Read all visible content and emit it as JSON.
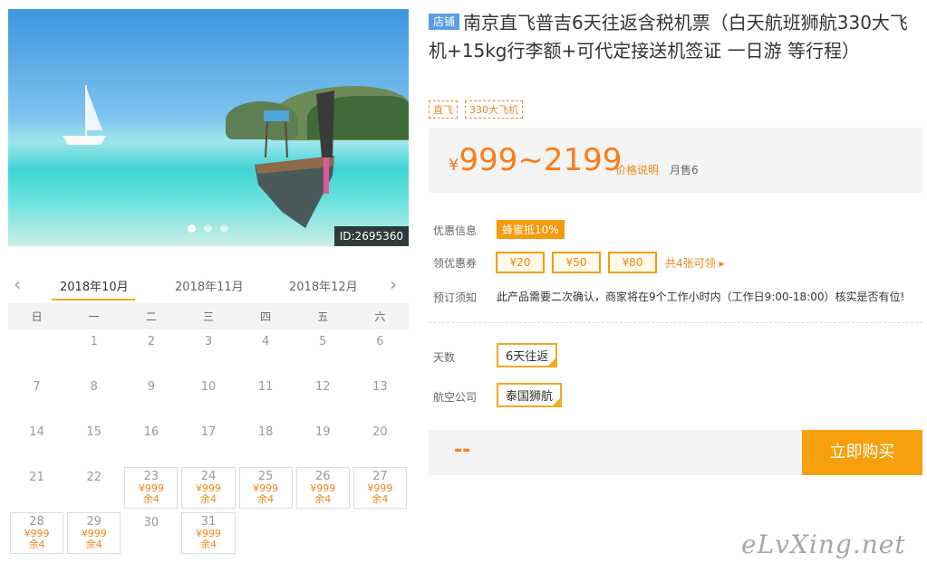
{
  "gallery": {
    "id_label": "ID:2695360",
    "dots": 3,
    "active_dot": 0
  },
  "calendar": {
    "months": [
      "2018年10月",
      "2018年11月",
      "2018年12月"
    ],
    "active_month": 0,
    "weekdays": [
      "日",
      "一",
      "二",
      "三",
      "四",
      "五",
      "六"
    ],
    "weeks": [
      [
        {
          "d": ""
        },
        {
          "d": "1"
        },
        {
          "d": "2"
        },
        {
          "d": "3"
        },
        {
          "d": "4"
        },
        {
          "d": "5"
        },
        {
          "d": "6"
        }
      ],
      [
        {
          "d": "7"
        },
        {
          "d": "8"
        },
        {
          "d": "9"
        },
        {
          "d": "10"
        },
        {
          "d": "11"
        },
        {
          "d": "12"
        },
        {
          "d": "13"
        }
      ],
      [
        {
          "d": "14"
        },
        {
          "d": "15"
        },
        {
          "d": "16"
        },
        {
          "d": "17"
        },
        {
          "d": "18"
        },
        {
          "d": "19"
        },
        {
          "d": "20"
        }
      ],
      [
        {
          "d": "21"
        },
        {
          "d": "22"
        },
        {
          "d": "23",
          "p": "¥999",
          "r": "余4"
        },
        {
          "d": "24",
          "p": "¥999",
          "r": "余4"
        },
        {
          "d": "25",
          "p": "¥999",
          "r": "余4"
        },
        {
          "d": "26",
          "p": "¥999",
          "r": "余4"
        },
        {
          "d": "27",
          "p": "¥999",
          "r": "余4"
        }
      ],
      [
        {
          "d": "28",
          "p": "¥999",
          "r": "余4"
        },
        {
          "d": "29",
          "p": "¥999",
          "r": "余4"
        },
        {
          "d": "30"
        },
        {
          "d": "31",
          "p": "¥999",
          "r": "余4"
        },
        {
          "d": ""
        },
        {
          "d": ""
        },
        {
          "d": ""
        }
      ]
    ]
  },
  "product": {
    "shop_badge": "店铺",
    "title": "南京直飞普吉6天往返含税机票（白天航班狮航330大飞机+15kg行李额+可代定接送机签证 一日游 等行程）",
    "tags": [
      "直飞",
      "330大飞机"
    ],
    "price_currency": "¥",
    "price_range": "999~2199",
    "price_note": "价格说明",
    "monthly_sales": "月售6"
  },
  "promo": {
    "label": "优惠信息",
    "honey": "蜂蜜抵10%",
    "coupon_label": "领优惠券",
    "coupons": [
      "¥20",
      "¥50",
      "¥80"
    ],
    "coupon_more": "共4张可领 ▸",
    "notice_label": "预订须知",
    "notice": "此产品需要二次确认，商家将在9个工作小时内（工作日9:00-18:00）核实是否有位!"
  },
  "options": {
    "days_label": "天数",
    "days_value": "6天往返",
    "airline_label": "航空公司",
    "airline_value": "泰国狮航"
  },
  "buy": {
    "total": "--",
    "button": "立即购买"
  },
  "watermark": "eLvXing.net"
}
